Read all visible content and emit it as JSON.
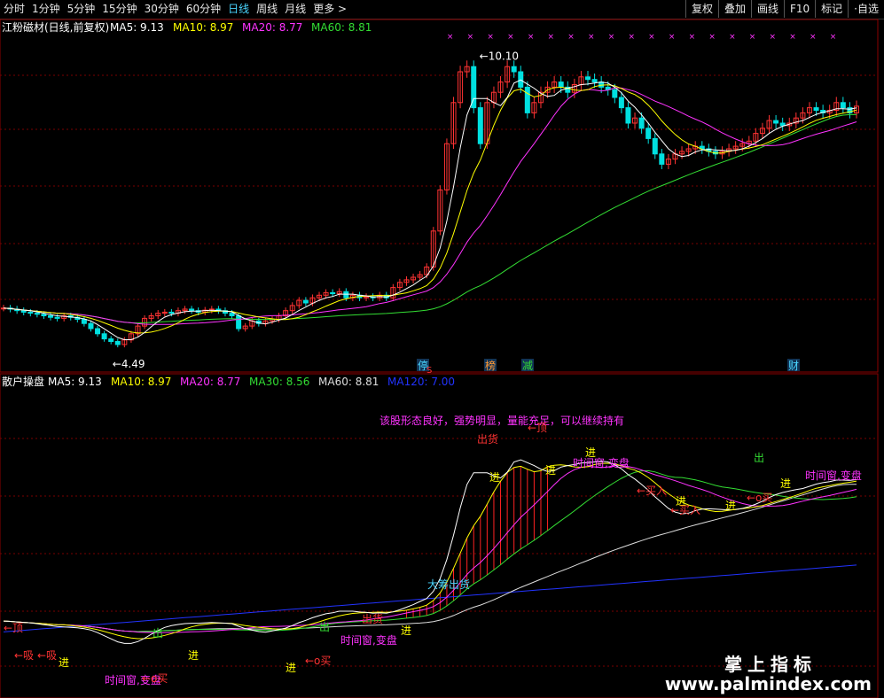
{
  "toolbar": {
    "tabs": [
      "分时",
      "1分钟",
      "5分钟",
      "15分钟",
      "30分钟",
      "60分钟",
      "日线",
      "周线",
      "月线",
      "更多 >"
    ],
    "active_tab": "日线",
    "buttons": [
      "复权",
      "叠加",
      "画线",
      "F10",
      "标记",
      "·自选"
    ]
  },
  "upper": {
    "title": "江粉磁材(日线,前复权)",
    "ma_labels": [
      {
        "text": "MA5: 9.13",
        "color": "#ffffff"
      },
      {
        "text": "MA10: 8.97",
        "color": "#ffff00"
      },
      {
        "text": "MA20: 8.77",
        "color": "#ff33ff"
      },
      {
        "text": "MA60: 8.81",
        "color": "#33dd33"
      }
    ],
    "high_label": "10.10",
    "low_label": "4.49",
    "event_tags": [
      {
        "text": "停",
        "color": "#4ad6ff"
      },
      {
        "text": "榜",
        "color": "#ff9933"
      },
      {
        "text": "减",
        "color": "#33dd33"
      },
      {
        "text": "财",
        "color": "#4ad6ff"
      }
    ],
    "event_mark": "S"
  },
  "lower": {
    "title": "散户操盘",
    "ma_labels": [
      {
        "text": "MA5: 9.13",
        "color": "#ffffff"
      },
      {
        "text": "MA10: 8.97",
        "color": "#ffff00"
      },
      {
        "text": "MA20: 8.77",
        "color": "#ff33ff"
      },
      {
        "text": "MA30: 8.56",
        "color": "#33dd33"
      },
      {
        "text": "MA60: 8.81",
        "color": "#dddddd"
      },
      {
        "text": "MA120: 7.00",
        "color": "#2233ff"
      }
    ],
    "comment": "该股形态良好，强势明显，量能充足，可以继续持有",
    "annotations": [
      {
        "text": "←顶",
        "color": "#ff3333"
      },
      {
        "text": "←吸",
        "color": "#ff3333"
      },
      {
        "text": "←吸",
        "color": "#ff3333"
      },
      {
        "text": "进",
        "color": "#ffff00"
      },
      {
        "text": "出",
        "color": "#33dd33"
      },
      {
        "text": "进",
        "color": "#ffff00"
      },
      {
        "text": "时间窗,变盘",
        "color": "#ff33ff"
      },
      {
        "text": "←o买",
        "color": "#ff3333"
      },
      {
        "text": "进",
        "color": "#ffff00"
      },
      {
        "text": "出",
        "color": "#33dd33"
      },
      {
        "text": "←o买",
        "color": "#ff3333"
      },
      {
        "text": "出货",
        "color": "#ff3333"
      },
      {
        "text": "时间窗,变盘",
        "color": "#ff33ff"
      },
      {
        "text": "进",
        "color": "#ffff00"
      },
      {
        "text": "大筹出货",
        "color": "#4ad6ff"
      },
      {
        "text": "出货",
        "color": "#ff3333"
      },
      {
        "text": "进",
        "color": "#ffff00"
      },
      {
        "text": "←顶",
        "color": "#ff3333"
      },
      {
        "text": "进",
        "color": "#ffff00"
      },
      {
        "text": "进",
        "color": "#ffff00"
      },
      {
        "text": "时间窗,变盘",
        "color": "#ff33ff"
      },
      {
        "text": "←买入",
        "color": "#ff3333"
      },
      {
        "text": "进",
        "color": "#ffff00"
      },
      {
        "text": "←买入",
        "color": "#ff3333"
      },
      {
        "text": "进",
        "color": "#ffff00"
      },
      {
        "text": "←o买",
        "color": "#ff3333"
      },
      {
        "text": "出",
        "color": "#33dd33"
      },
      {
        "text": "进",
        "color": "#ffff00"
      },
      {
        "text": "时间窗,变盘",
        "color": "#ff33ff"
      }
    ]
  },
  "watermark": {
    "line1": "掌上指标",
    "line2": "www.palmindex.com"
  },
  "colors": {
    "up": "#ff3333",
    "down": "#00e0e0",
    "ma5": "#ffffff",
    "ma10": "#ffff00",
    "ma20": "#ff33ff",
    "ma60": "#33dd33",
    "ma120": "#2233ff",
    "grid": "#7a0000"
  },
  "chart_data": {
    "type": "line",
    "description_series": "daily close, 128 trading days",
    "close": [
      5.2,
      5.18,
      5.15,
      5.12,
      5.1,
      5.08,
      5.05,
      5.02,
      5.0,
      5.05,
      5.02,
      4.98,
      4.9,
      4.8,
      4.7,
      4.6,
      4.55,
      4.49,
      4.58,
      4.7,
      4.85,
      5.0,
      5.05,
      5.1,
      5.12,
      5.1,
      5.15,
      5.18,
      5.15,
      5.12,
      5.16,
      5.18,
      5.15,
      5.1,
      5.05,
      4.8,
      4.85,
      4.95,
      4.9,
      4.95,
      4.98,
      5.05,
      5.15,
      5.25,
      5.35,
      5.3,
      5.4,
      5.45,
      5.5,
      5.48,
      5.52,
      5.4,
      5.45,
      5.4,
      5.42,
      5.4,
      5.45,
      5.4,
      5.6,
      5.7,
      5.75,
      5.8,
      5.85,
      6.0,
      6.7,
      7.5,
      8.4,
      9.2,
      9.8,
      9.9,
      9.1,
      8.4,
      9.2,
      9.4,
      9.6,
      9.9,
      9.8,
      9.5,
      9.0,
      9.2,
      9.4,
      9.5,
      9.6,
      9.5,
      9.4,
      9.55,
      9.7,
      9.65,
      9.6,
      9.5,
      9.45,
      9.3,
      9.1,
      8.8,
      8.9,
      8.7,
      8.5,
      8.2,
      8.0,
      8.1,
      8.2,
      8.25,
      8.3,
      8.35,
      8.3,
      8.25,
      8.2,
      8.25,
      8.3,
      8.35,
      8.4,
      8.45,
      8.6,
      8.7,
      8.85,
      8.8,
      8.75,
      8.8,
      8.9,
      9.0,
      9.1,
      9.05,
      9.0,
      9.05,
      9.2,
      9.1,
      9.0,
      9.13
    ],
    "ma_values_last": {
      "MA5": 9.13,
      "MA10": 8.97,
      "MA20": 8.77,
      "MA60": 8.81,
      "MA30": 8.56,
      "MA120": 7.0
    },
    "high": 10.1,
    "low": 4.49
  }
}
